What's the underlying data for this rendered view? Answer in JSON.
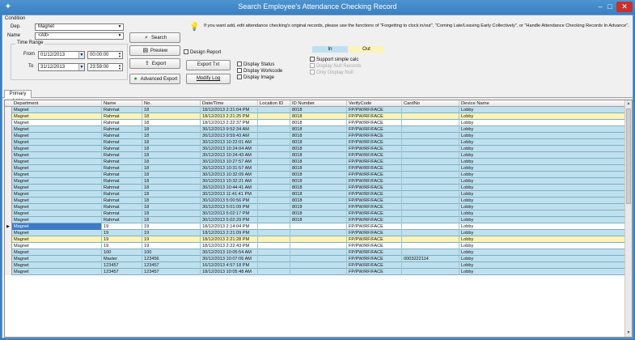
{
  "window": {
    "title": "Search Employee's Attendance Checking Record",
    "minimize": "–",
    "maximize": "□",
    "close": "✕"
  },
  "condition": {
    "label": "Condition",
    "dept_label": "Dep.",
    "dept_value": "Magnet",
    "name_label": "Name",
    "name_value": "<All>",
    "time_range_label": "Time Range",
    "from_label": "From",
    "from_date": "01/12/2013",
    "from_time": "00:00:00",
    "to_label": "To",
    "to_date": "31/12/2013",
    "to_time": "23:59:00"
  },
  "buttons": {
    "search": "Search",
    "preview": "Preview",
    "export": "Export",
    "advanced_export": "Advanced Export",
    "export_txt": "Export Txt",
    "modify_log": "Modify Log"
  },
  "checks": {
    "design_report": "Design Report",
    "display_status": "Display Status",
    "display_workcode": "Display Workcode",
    "display_image": "Display Image",
    "support_simple_calc": "Support simple calc",
    "display_null_records": "Display Null Records",
    "only_display_null": "Only Display Null"
  },
  "info_text": "If you want add, edit attendance checking's original records, please use the functions of \"Forgetting to clock in/out\", \"Coming Late/Leaving Early Collectively\", or \"Handle Attendance Checking Records In Advance\".",
  "legend": {
    "in": "In",
    "out": "Out",
    "in_color": "#bfe0ef",
    "out_color": "#fbf3b8"
  },
  "tabs": [
    {
      "label": "Primary Logs"
    }
  ],
  "table": {
    "columns": [
      "Department",
      "Name",
      "No.",
      "Date/Time",
      "Location ID",
      "ID Number",
      "VerifyCode",
      "CardNo",
      "Device Name"
    ],
    "rows": [
      {
        "dept": "Magnet",
        "name": "Rahmat",
        "no": "18",
        "time": "18/12/2013 2:21:04 PM",
        "loc": "",
        "idnum": "8018",
        "verify": "FP/PW/RF/FACE",
        "card": "",
        "device": "Lobby",
        "state": "in"
      },
      {
        "dept": "Magnet",
        "name": "Rahmat",
        "no": "18",
        "time": "18/12/2013 2:21:25 PM",
        "loc": "",
        "idnum": "8018",
        "verify": "FP/PW/RF/FACE",
        "card": "",
        "device": "Lobby",
        "state": "out"
      },
      {
        "dept": "Magnet",
        "name": "Rahmat",
        "no": "18",
        "time": "18/12/2013 2:22:37 PM",
        "loc": "",
        "idnum": "8018",
        "verify": "FP/PW/RF/FACE",
        "card": "",
        "device": "Lobby",
        "state": "none"
      },
      {
        "dept": "Magnet",
        "name": "Rahmat",
        "no": "18",
        "time": "30/12/2013 9:52:34 AM",
        "loc": "",
        "idnum": "8018",
        "verify": "FP/PW/RF/FACE",
        "card": "",
        "device": "Lobby",
        "state": "in"
      },
      {
        "dept": "Magnet",
        "name": "Rahmat",
        "no": "18",
        "time": "30/12/2013 9:59:43 AM",
        "loc": "",
        "idnum": "8018",
        "verify": "FP/PW/RF/FACE",
        "card": "",
        "device": "Lobby",
        "state": "in"
      },
      {
        "dept": "Magnet",
        "name": "Rahmat",
        "no": "18",
        "time": "30/12/2013 10:22:01 AM",
        "loc": "",
        "idnum": "8018",
        "verify": "FP/PW/RF/FACE",
        "card": "",
        "device": "Lobby",
        "state": "in"
      },
      {
        "dept": "Magnet",
        "name": "Rahmat",
        "no": "18",
        "time": "30/12/2013 10:24:04 AM",
        "loc": "",
        "idnum": "8018",
        "verify": "FP/PW/RF/FACE",
        "card": "",
        "device": "Lobby",
        "state": "in"
      },
      {
        "dept": "Magnet",
        "name": "Rahmat",
        "no": "18",
        "time": "30/12/2013 10:24:43 AM",
        "loc": "",
        "idnum": "8018",
        "verify": "FP/PW/RF/FACE",
        "card": "",
        "device": "Lobby",
        "state": "in"
      },
      {
        "dept": "Magnet",
        "name": "Rahmat",
        "no": "18",
        "time": "30/12/2013 10:27:57 AM",
        "loc": "",
        "idnum": "8018",
        "verify": "FP/PW/RF/FACE",
        "card": "",
        "device": "Lobby",
        "state": "in"
      },
      {
        "dept": "Magnet",
        "name": "Rahmat",
        "no": "18",
        "time": "30/12/2013 10:31:57 AM",
        "loc": "",
        "idnum": "8018",
        "verify": "FP/PW/RF/FACE",
        "card": "",
        "device": "Lobby",
        "state": "in"
      },
      {
        "dept": "Magnet",
        "name": "Rahmat",
        "no": "18",
        "time": "30/12/2013 10:32:09 AM",
        "loc": "",
        "idnum": "8018",
        "verify": "FP/PW/RF/FACE",
        "card": "",
        "device": "Lobby",
        "state": "in"
      },
      {
        "dept": "Magnet",
        "name": "Rahmat",
        "no": "18",
        "time": "30/12/2013 10:32:21 AM",
        "loc": "",
        "idnum": "8018",
        "verify": "FP/PW/RF/FACE",
        "card": "",
        "device": "Lobby",
        "state": "in"
      },
      {
        "dept": "Magnet",
        "name": "Rahmat",
        "no": "18",
        "time": "30/12/2013 10:44:41 AM",
        "loc": "",
        "idnum": "8018",
        "verify": "FP/PW/RF/FACE",
        "card": "",
        "device": "Lobby",
        "state": "in"
      },
      {
        "dept": "Magnet",
        "name": "Rahmat",
        "no": "18",
        "time": "30/12/2013 11:41:41 PM",
        "loc": "",
        "idnum": "8018",
        "verify": "FP/PW/RF/FACE",
        "card": "",
        "device": "Lobby",
        "state": "in"
      },
      {
        "dept": "Magnet",
        "name": "Rahmat",
        "no": "18",
        "time": "30/12/2013 5:00:56 PM",
        "loc": "",
        "idnum": "8018",
        "verify": "FP/PW/RF/FACE",
        "card": "",
        "device": "Lobby",
        "state": "in"
      },
      {
        "dept": "Magnet",
        "name": "Rahmat",
        "no": "18",
        "time": "30/12/2013 5:01:09 PM",
        "loc": "",
        "idnum": "8018",
        "verify": "FP/PW/RF/FACE",
        "card": "",
        "device": "Lobby",
        "state": "in"
      },
      {
        "dept": "Magnet",
        "name": "Rahmat",
        "no": "18",
        "time": "30/12/2013 5:02:17 PM",
        "loc": "",
        "idnum": "8018",
        "verify": "FP/PW/RF/FACE",
        "card": "",
        "device": "Lobby",
        "state": "in"
      },
      {
        "dept": "Magnet",
        "name": "Rahmat",
        "no": "18",
        "time": "30/12/2013 5:02:29 PM",
        "loc": "",
        "idnum": "8018",
        "verify": "FP/PW/RF/FACE",
        "card": "",
        "device": "Lobby",
        "state": "in"
      },
      {
        "dept": "Magnet",
        "name": "19",
        "no": "19",
        "time": "18/12/2013 2:14:04 PM",
        "loc": "",
        "idnum": "",
        "verify": "FP/PW/RF/FACE",
        "card": "",
        "device": "Lobby",
        "state": "selected"
      },
      {
        "dept": "Magnet",
        "name": "19",
        "no": "19",
        "time": "18/12/2013 2:21:09 PM",
        "loc": "",
        "idnum": "",
        "verify": "FP/PW/RF/FACE",
        "card": "",
        "device": "Lobby",
        "state": "in"
      },
      {
        "dept": "Magnet",
        "name": "19",
        "no": "19",
        "time": "18/12/2013 2:21:28 PM",
        "loc": "",
        "idnum": "",
        "verify": "FP/PW/RF/FACE",
        "card": "",
        "device": "Lobby",
        "state": "out"
      },
      {
        "dept": "Magnet",
        "name": "19",
        "no": "19",
        "time": "18/12/2013 2:22:43 PM",
        "loc": "",
        "idnum": "",
        "verify": "FP/PW/RF/FACE",
        "card": "",
        "device": "Lobby",
        "state": "none"
      },
      {
        "dept": "Magnet",
        "name": "100",
        "no": "100",
        "time": "30/12/2013 10:05:54 AM",
        "loc": "",
        "idnum": "",
        "verify": "FP/PW/RF/FACE",
        "card": "",
        "device": "Lobby",
        "state": "in"
      },
      {
        "dept": "Magnet",
        "name": "Master",
        "no": "123456",
        "time": "30/12/2013 10:07:06 AM",
        "loc": "",
        "idnum": "",
        "verify": "FP/PW/RF/FACE",
        "card": "0003222114",
        "device": "Lobby",
        "state": "in"
      },
      {
        "dept": "Magnet",
        "name": "123457",
        "no": "123457",
        "time": "16/12/2013 4:57:18 PM",
        "loc": "",
        "idnum": "",
        "verify": "FP/PW/RF/FACE",
        "card": "",
        "device": "Lobby",
        "state": "in"
      },
      {
        "dept": "Magnet",
        "name": "123457",
        "no": "123457",
        "time": "18/12/2013 10:05:48 AM",
        "loc": "",
        "idnum": "",
        "verify": "FP/PW/RF/FACE",
        "card": "",
        "device": "Lobby",
        "state": "in"
      }
    ]
  },
  "colors": {
    "selected_row": "#3d79c6"
  }
}
